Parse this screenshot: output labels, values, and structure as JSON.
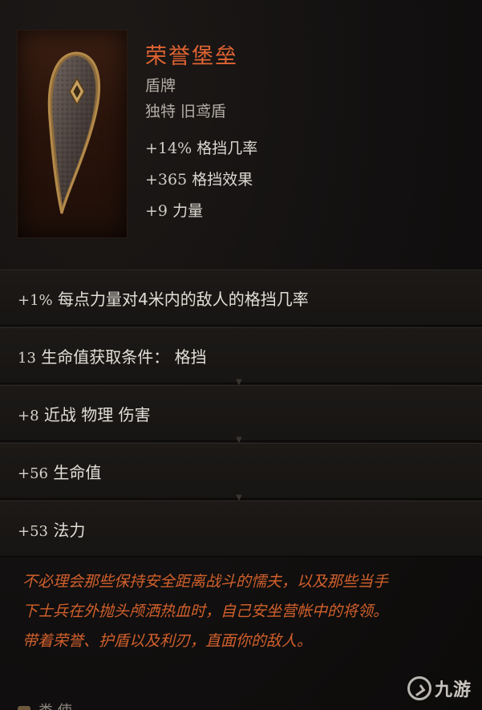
{
  "item": {
    "name": "荣誉堡垒",
    "type": "盾牌",
    "subtype": "独特 旧鸢盾",
    "icon": "kite-shield-icon",
    "base_stats": [
      {
        "value": "+14%",
        "label": "格挡几率"
      },
      {
        "value": "+365",
        "label": "格挡效果"
      },
      {
        "value": "+9",
        "label": "力量"
      }
    ]
  },
  "affixes": [
    {
      "value": "+1%",
      "label": "每点力量对4米内的敌人的格挡几率"
    },
    {
      "value": "13",
      "label": "生命值获取条件：  格挡"
    },
    {
      "value": "+8",
      "label": "近战 物理 伤害"
    },
    {
      "value": "+56",
      "label": "生命值"
    },
    {
      "value": "+53",
      "label": "法力"
    }
  ],
  "lore": [
    "不必理会那些保持安全距离战斗的懦夫，以及那些当手",
    "下士兵在外抛头颅洒热血时，自己安坐营帐中的将领。",
    "带着荣誉、护盾以及利刃，直面你的敌人。"
  ],
  "footer": {
    "label": "类 使"
  },
  "watermark": {
    "text": "九游"
  },
  "colors": {
    "item_name": "#e06432",
    "lore": "#d2602c",
    "stat_text": "#dcd8d2",
    "subtitle": "#b3ada5",
    "background": "#121010"
  }
}
